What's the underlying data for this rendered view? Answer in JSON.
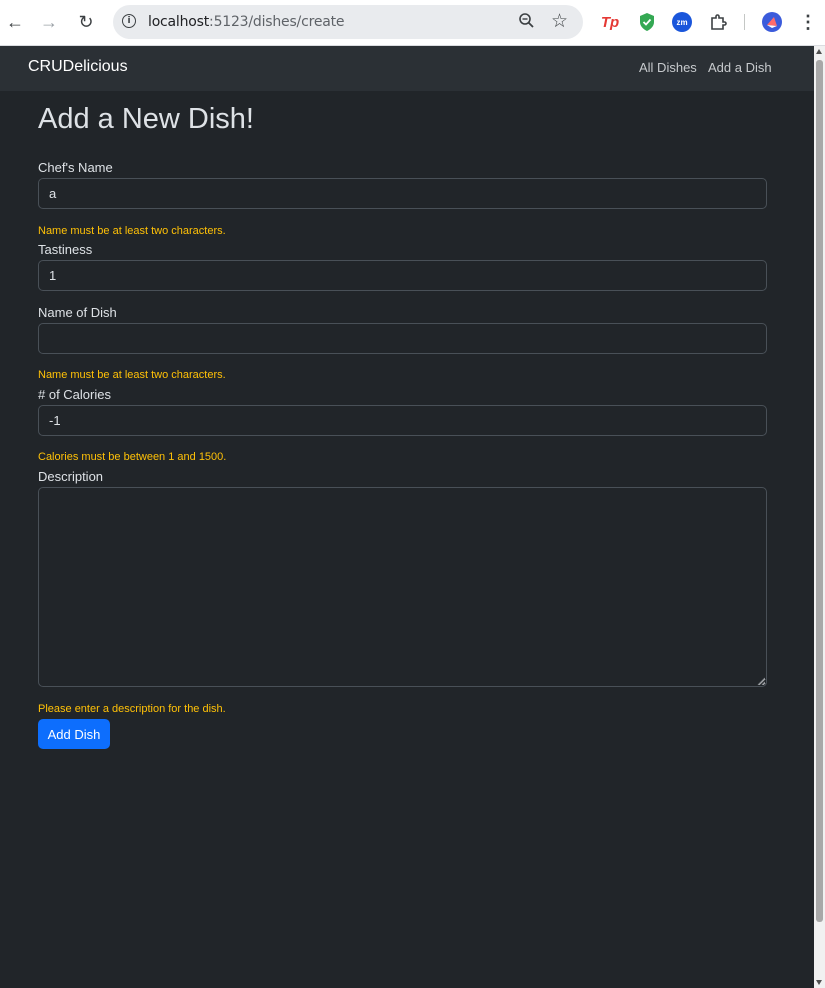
{
  "browser": {
    "url_host": "localhost",
    "url_path": ":5123/dishes/create",
    "extensions": [
      "tp-icon",
      "shield-icon",
      "zoom-icon",
      "puzzle-icon",
      "avatar-icon"
    ]
  },
  "navbar": {
    "brand": "CRUDelicious",
    "links": [
      "All Dishes",
      "Add a Dish"
    ]
  },
  "page": {
    "title": "Add a New Dish!"
  },
  "form": {
    "chef_name": {
      "label": "Chef's Name",
      "value": "a",
      "error": "Name must be at least two characters."
    },
    "tastiness": {
      "label": "Tastiness",
      "value": "1"
    },
    "dish_name": {
      "label": "Name of Dish",
      "value": "",
      "error": "Name must be at least two characters."
    },
    "calories": {
      "label": "# of Calories",
      "value": "-1",
      "error": "Calories must be between 1 and 1500."
    },
    "description": {
      "label": "Description",
      "value": "",
      "error": "Please enter a description for the dish."
    },
    "submit_label": "Add Dish"
  },
  "colors": {
    "background": "#212529",
    "navbar": "#2b3035",
    "error": "#ffc107",
    "primary": "#0d6efd"
  }
}
